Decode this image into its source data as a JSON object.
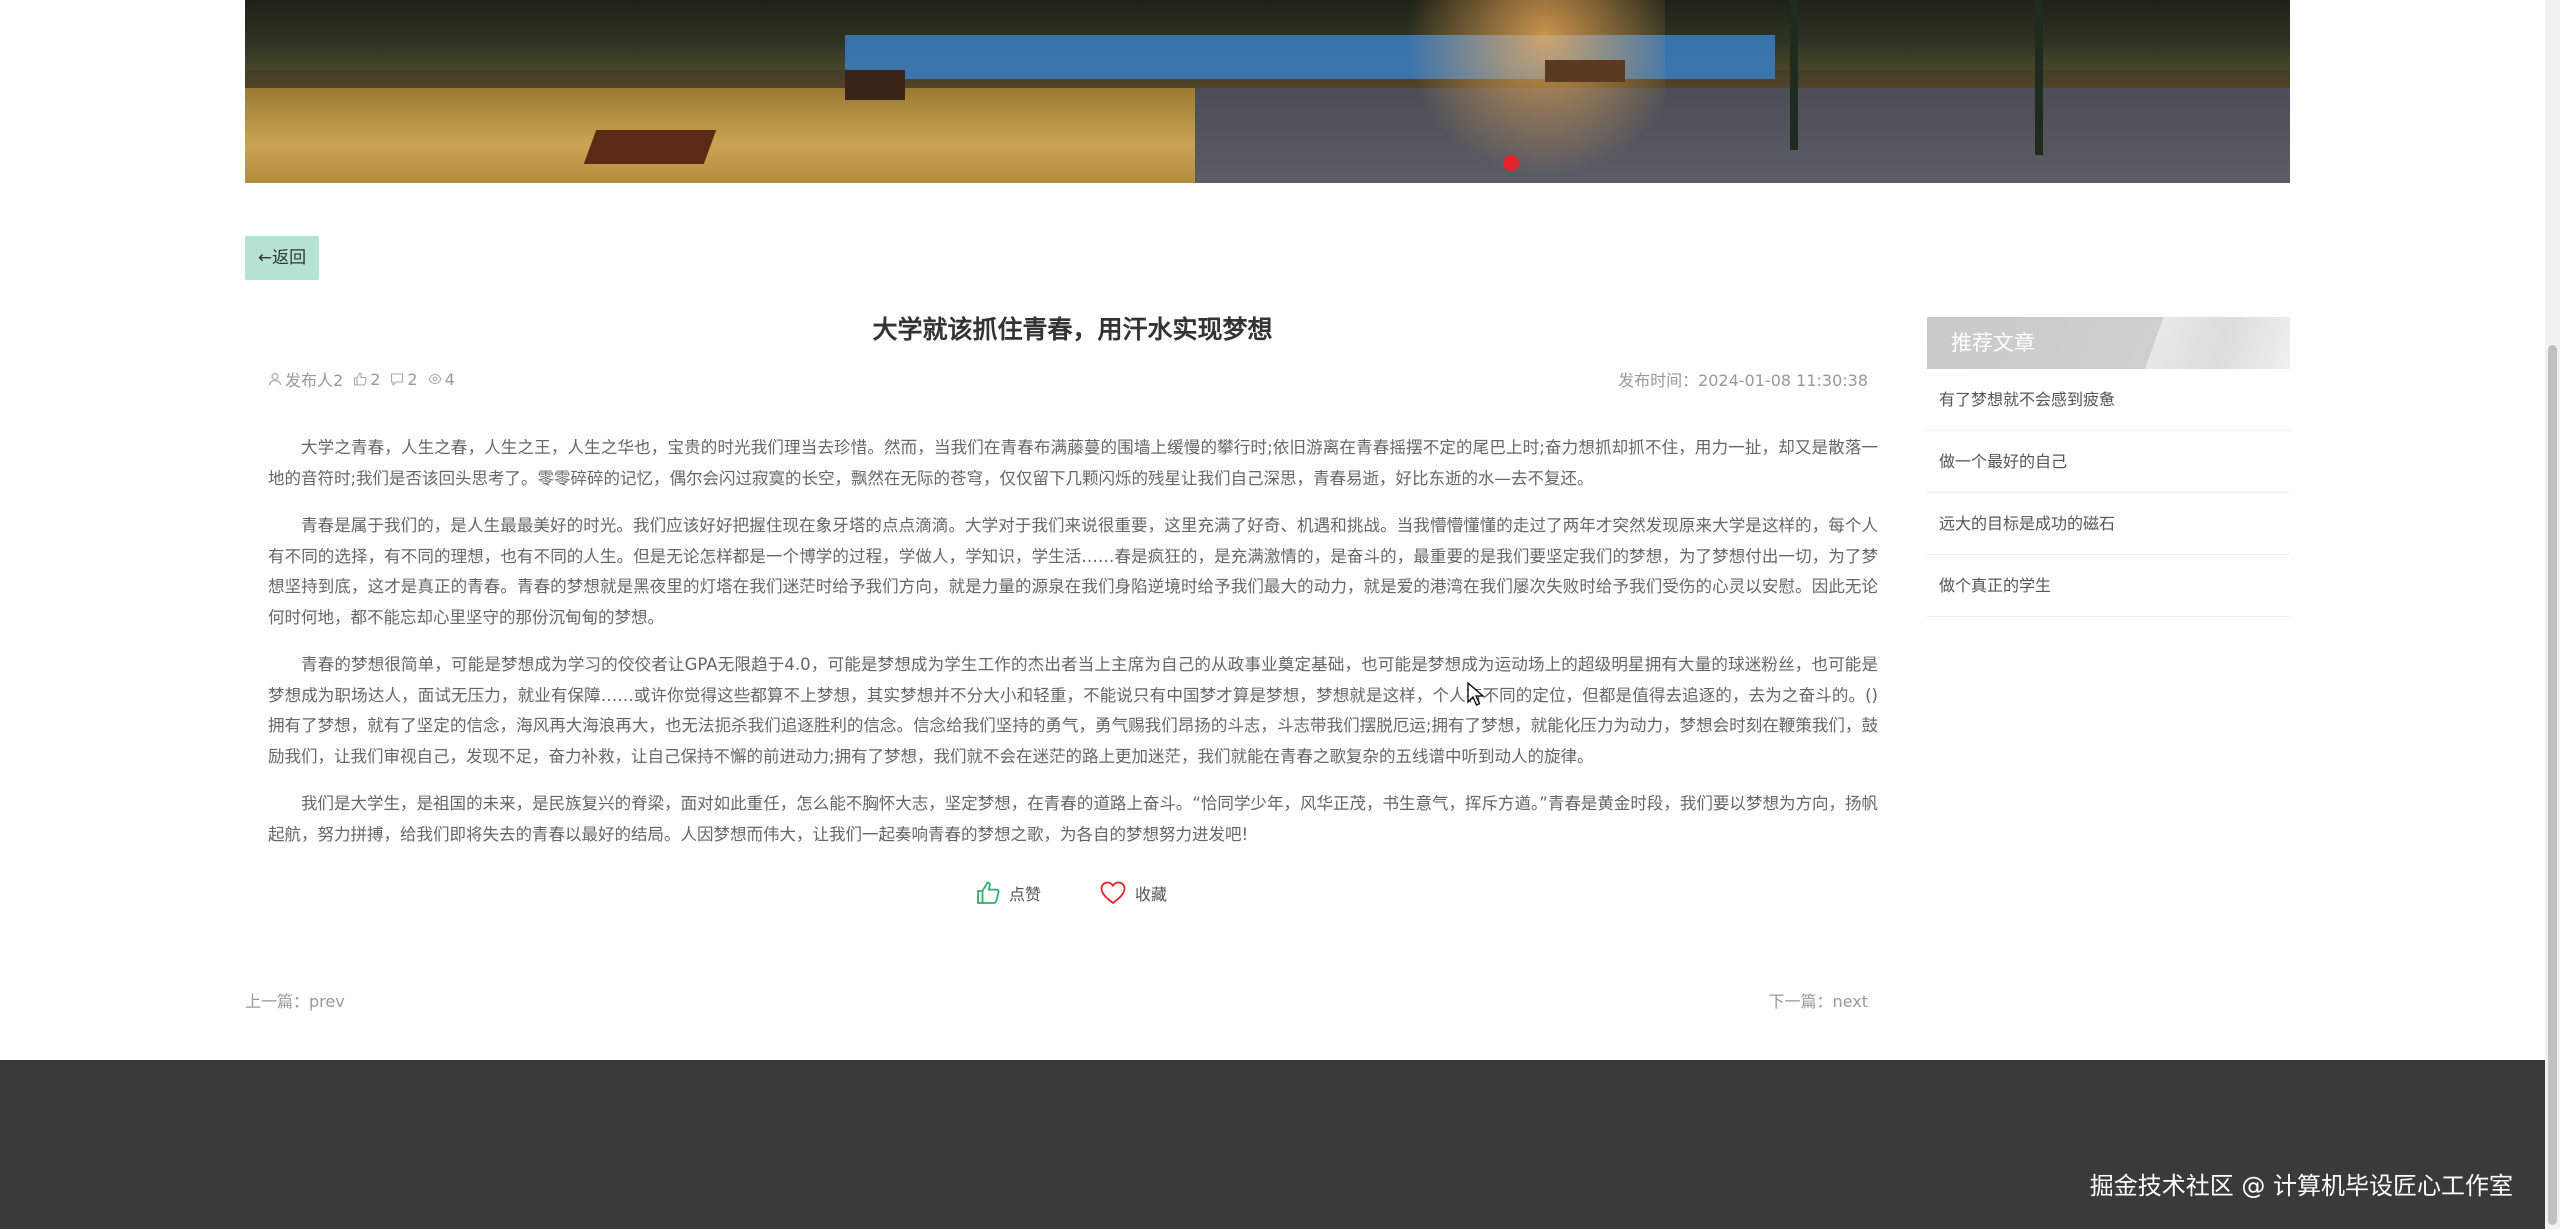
{
  "banner": {
    "carousel_active_index": 1
  },
  "nav": {
    "back_label": "←返回"
  },
  "article": {
    "title": "大学就该抓住青春，用汗水实现梦想",
    "author": "发布人2",
    "likes": "2",
    "comments": "2",
    "views": "4",
    "publish_time": "发布时间：2024-01-08 11:30:38",
    "paragraphs": [
      "大学之青春，人生之春，人生之王，人生之华也，宝贵的时光我们理当去珍惜。然而，当我们在青春布满藤蔓的围墙上缓慢的攀行时;依旧游离在青春摇摆不定的尾巴上时;奋力想抓却抓不住，用力一扯，却又是散落一地的音符时;我们是否该回头思考了。零零碎碎的记忆，偶尔会闪过寂寞的长空，飘然在无际的苍穹，仅仅留下几颗闪烁的残星让我们自己深思，青春易逝，好比东逝的水—去不复还。",
      "青春是属于我们的，是人生最最美好的时光。我们应该好好把握住现在象牙塔的点点滴滴。大学对于我们来说很重要，这里充满了好奇、机遇和挑战。当我懵懵懂懂的走过了两年才突然发现原来大学是这样的，每个人有不同的选择，有不同的理想，也有不同的人生。但是无论怎样都是一个博学的过程，学做人，学知识，学生活……春是疯狂的，是充满激情的，是奋斗的，最重要的是我们要坚定我们的梦想，为了梦想付出一切，为了梦想坚持到底，这才是真正的青春。青春的梦想就是黑夜里的灯塔在我们迷茫时给予我们方向，就是力量的源泉在我们身陷逆境时给予我们最大的动力，就是爱的港湾在我们屡次失败时给予我们受伤的心灵以安慰。因此无论何时何地，都不能忘却心里坚守的那份沉甸甸的梦想。",
      "青春的梦想很简单，可能是梦想成为学习的佼佼者让GPA无限趋于4.0，可能是梦想成为学生工作的杰出者当上主席为自己的从政事业奠定基础，也可能是梦想成为运动场上的超级明星拥有大量的球迷粉丝，也可能是梦想成为职场达人，面试无压力，就业有保障……或许你觉得这些都算不上梦想，其实梦想并不分大小和轻重，不能说只有中国梦才算是梦想，梦想就是这样，个人有不同的定位，但都是值得去追逐的，去为之奋斗的。()拥有了梦想，就有了坚定的信念，海风再大海浪再大，也无法扼杀我们追逐胜利的信念。信念给我们坚持的勇气，勇气赐我们昂扬的斗志，斗志带我们摆脱厄运;拥有了梦想，就能化压力为动力，梦想会时刻在鞭策我们，鼓励我们，让我们审视自己，发现不足，奋力补救，让自己保持不懈的前进动力;拥有了梦想，我们就不会在迷茫的路上更加迷茫，我们就能在青春之歌复杂的五线谱中听到动人的旋律。",
      "我们是大学生，是祖国的未来，是民族复兴的脊梁，面对如此重任，怎么能不胸怀大志，坚定梦想，在青春的道路上奋斗。“恰同学少年，风华正茂，书生意气，挥斥方遒。”青春是黄金时段，我们要以梦想为方向，扬帆起航，努力拼搏，给我们即将失去的青春以最好的结局。人因梦想而伟大，让我们一起奏响青春的梦想之歌，为各自的梦想努力进发吧!"
    ],
    "like_label": "点赞",
    "favorite_label": "收藏",
    "prev_label": "上一篇：prev",
    "next_label": "下一篇：next"
  },
  "sidebar": {
    "title": "推荐文章",
    "items": [
      {
        "label": "有了梦想就不会感到疲惫"
      },
      {
        "label": "做一个最好的自己"
      },
      {
        "label": "远大的目标是成功的磁石"
      },
      {
        "label": "做个真正的学生"
      }
    ]
  },
  "footer": {
    "watermark": "掘金技术社区 @ 计算机毕设匠心工作室"
  },
  "colors": {
    "accent": "#b6e3cf",
    "carousel_dot": "#e5242a",
    "footer_bg": "#3a3a3a",
    "like_icon": "#2fae6e",
    "favorite_icon": "#e5242a"
  },
  "icons": [
    "user-icon",
    "thumb-up-icon",
    "comment-icon",
    "eye-icon",
    "like-icon",
    "heart-icon"
  ]
}
